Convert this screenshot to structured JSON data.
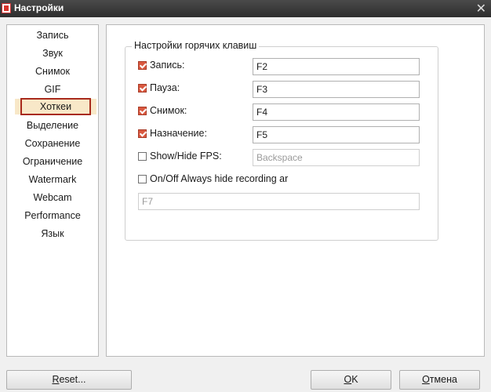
{
  "window": {
    "title": "Настройки",
    "close_glyph": "✕"
  },
  "sidebar": {
    "items": [
      {
        "label": "Запись"
      },
      {
        "label": "Звук"
      },
      {
        "label": "Снимок"
      },
      {
        "label": "GIF"
      },
      {
        "label": "Хоткеи",
        "selected": true
      },
      {
        "label": "Выделение"
      },
      {
        "label": "Сохранение"
      },
      {
        "label": "Ограничение"
      },
      {
        "label": "Watermark"
      },
      {
        "label": "Webcam"
      },
      {
        "label": "Performance"
      },
      {
        "label": "Язык"
      }
    ]
  },
  "hotkeys": {
    "group_title": "Настройки горячих клавиш",
    "rows": [
      {
        "label": "Запись:",
        "checked": true,
        "value": "F2"
      },
      {
        "label": "Пауза:",
        "checked": true,
        "value": "F3"
      },
      {
        "label": "Снимок:",
        "checked": true,
        "value": "F4"
      },
      {
        "label": "Назначение:",
        "checked": true,
        "value": "F5"
      },
      {
        "label": "Show/Hide FPS:",
        "checked": false,
        "value": "Backspace"
      }
    ],
    "always_hide": {
      "label": "On/Off Always hide recording ar",
      "checked": false,
      "value": "F7"
    }
  },
  "buttons": {
    "reset": {
      "mnemonic": "R",
      "rest": "eset..."
    },
    "ok": {
      "mnemonic": "O",
      "rest": "K"
    },
    "cancel": {
      "mnemonic": "О",
      "rest": "тмена"
    }
  },
  "colors": {
    "accent": "#d9583f",
    "selection_border": "#a82a1c",
    "selection_bg": "#f8e8c8"
  }
}
